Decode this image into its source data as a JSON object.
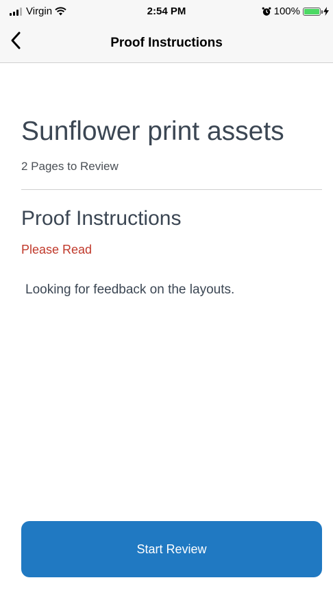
{
  "status_bar": {
    "carrier": "Virgin",
    "time": "2:54 PM",
    "battery_percent": "100%",
    "battery_level": 1.0,
    "battery_color": "#4cd964",
    "icons": [
      "signal-icon",
      "wifi-icon",
      "alarm-icon",
      "battery-icon",
      "charging-icon"
    ]
  },
  "nav": {
    "back_icon": "chevron-left-icon",
    "title": "Proof Instructions"
  },
  "proof": {
    "title": "Sunflower print assets",
    "pages_count": "2 Pages to Review"
  },
  "instructions": {
    "heading": "Proof Instructions",
    "notice": "Please Read",
    "notice_color": "#c0392b",
    "text": "Looking for feedback on the layouts."
  },
  "actions": {
    "start_review": "Start Review",
    "button_color": "#2079c2"
  }
}
